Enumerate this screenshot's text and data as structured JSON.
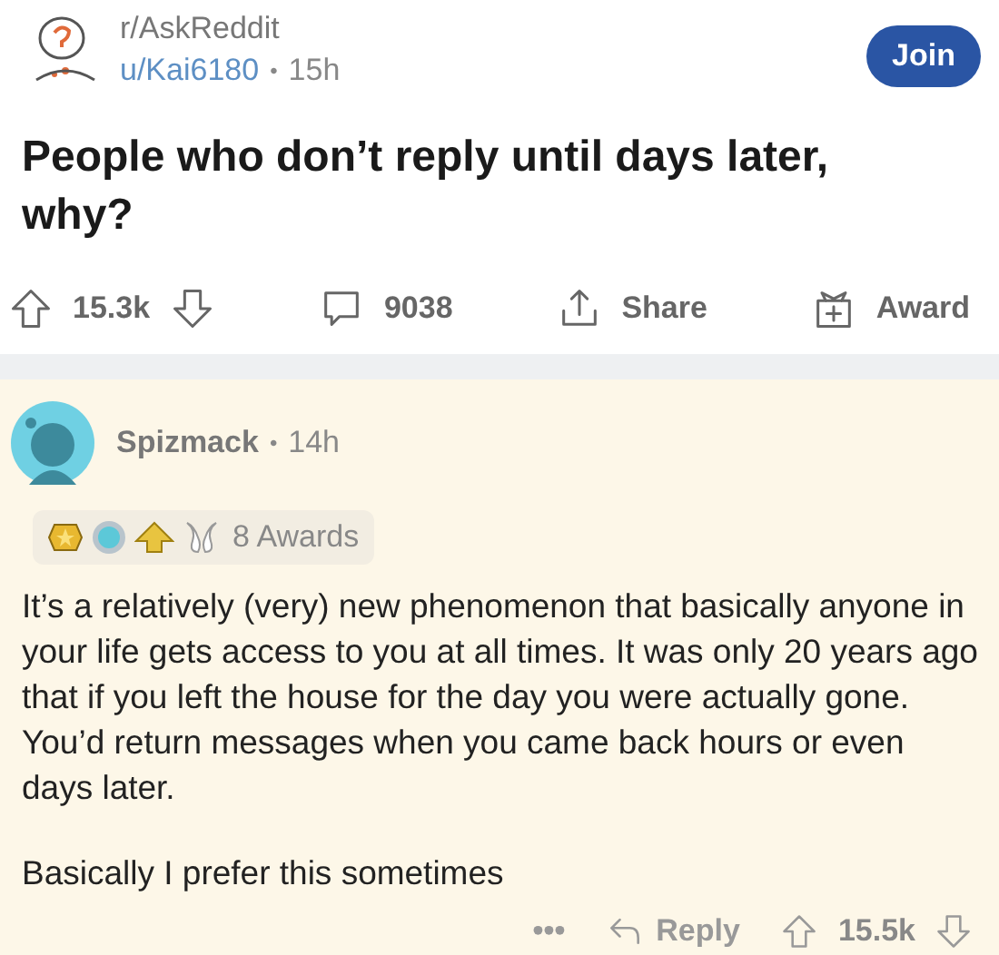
{
  "post": {
    "subreddit": "r/AskReddit",
    "author": "u/Kai6180",
    "separator": "•",
    "time": "15h",
    "join_button": "Join",
    "title": "People who don’t reply until days later, why?"
  },
  "post_actions": {
    "score": "15.3k",
    "comments": "9038",
    "share": "Share",
    "award": "Award"
  },
  "comment": {
    "author": "Spizmack",
    "separator": "•",
    "time": "14h",
    "awards": "8 Awards",
    "paragraphs": [
      "It’s a relatively (very) new phenomenon that basically anyone in your life gets access to you at all times. It was only 20 years ago that if you left the house for the day you were actually gone. You’d return messages when you came back hours or even days later.",
      "Basically I prefer this sometimes"
    ],
    "more": "•••",
    "reply": "Reply",
    "score": "15.5k"
  }
}
